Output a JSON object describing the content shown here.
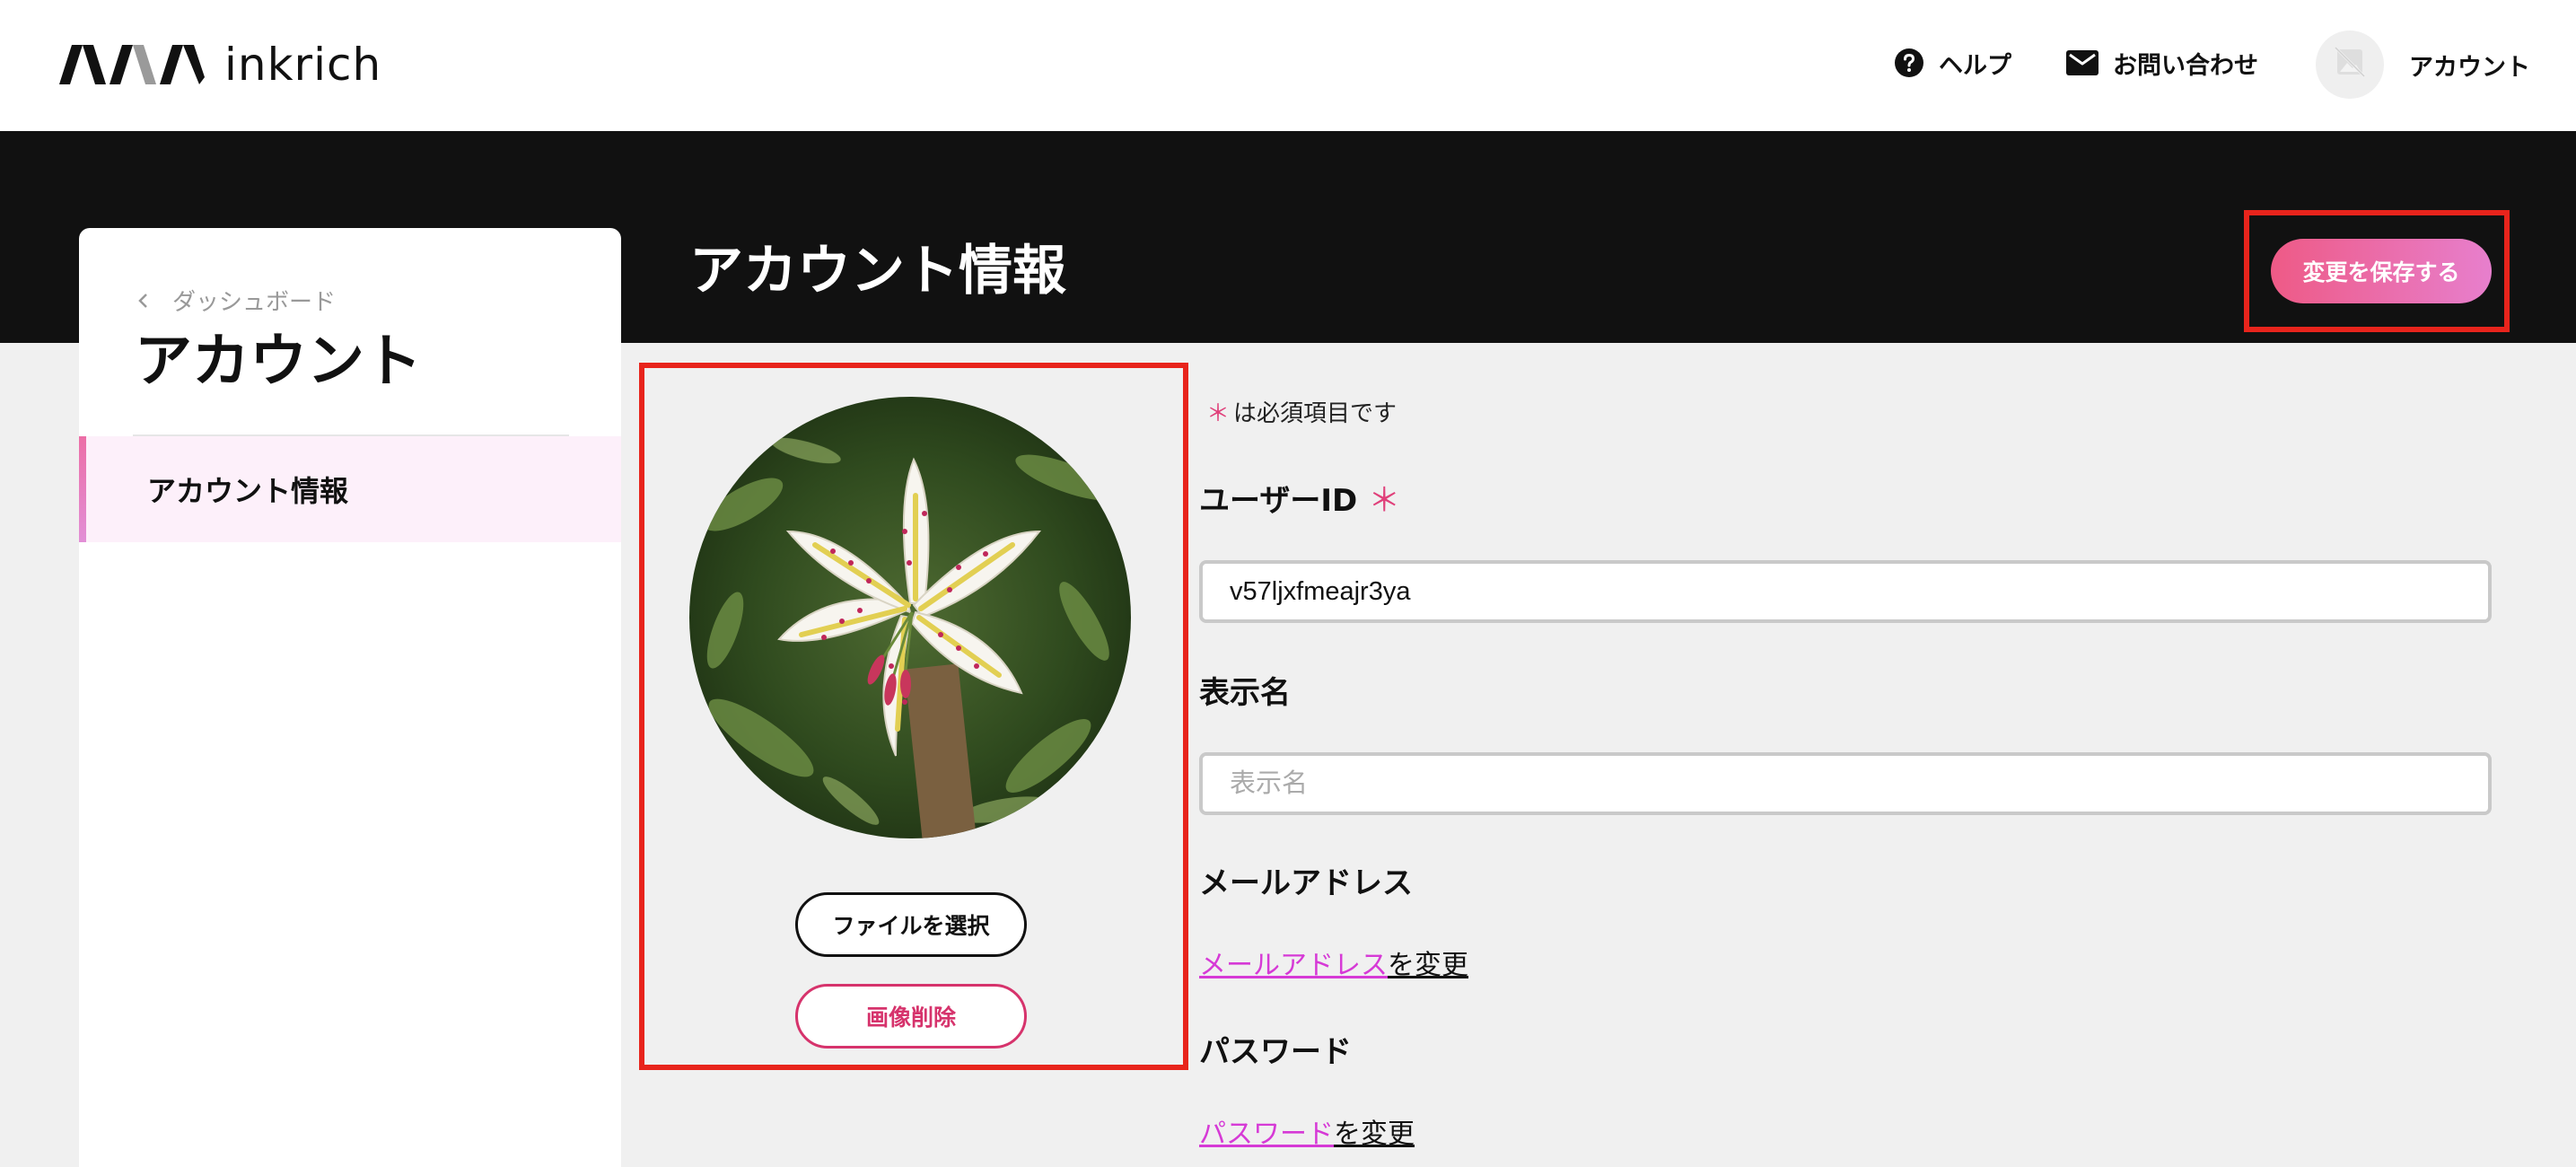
{
  "header": {
    "logo_text": "inkrich",
    "help_label": "ヘルプ",
    "contact_label": "お問い合わせ",
    "account_label": "アカウント"
  },
  "page": {
    "title": "アカウント情報",
    "save_label": "変更を保存する"
  },
  "sidebar": {
    "back_label": "ダッシュボード",
    "title": "アカウント",
    "items": [
      {
        "label": "アカウント情報",
        "active": true
      }
    ]
  },
  "avatar": {
    "file_button_label": "ファイルを選択",
    "delete_button_label": "画像削除"
  },
  "form": {
    "required_mark": "＊",
    "required_note": "は必須項目です",
    "user_id_label": "ユーザーID",
    "user_id_value": "v57ljxfmeajr3ya",
    "display_name_label": "表示名",
    "display_name_placeholder": "表示名",
    "display_name_value": "",
    "email_label": "メールアドレス",
    "email_link": "メールアドレス",
    "email_link_suffix": "を変更",
    "password_label": "パスワード",
    "password_link": "パスワード",
    "password_link_suffix": "を変更"
  },
  "colors": {
    "accent_pink": "#e0407a",
    "link_magenta": "#d63ad6",
    "annotation_red": "#e8241c",
    "dark_band": "#111111"
  },
  "icons": {
    "help": "question-circle-icon",
    "contact": "envelope-icon",
    "account": "image-off-icon",
    "back": "chevron-left-icon"
  }
}
